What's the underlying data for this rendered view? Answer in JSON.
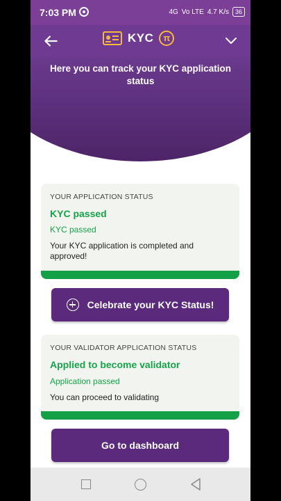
{
  "status_bar": {
    "time": "7:03 PM",
    "network": "4G",
    "volte": "Vo LTE",
    "speed": "4.7 K/s",
    "battery": "36"
  },
  "header": {
    "title": "KYC",
    "pi_symbol": "π"
  },
  "hero": {
    "text": "Here you can track your KYC application status"
  },
  "kyc_card": {
    "caption": "YOUR APPLICATION STATUS",
    "title": "KYC passed",
    "subtitle": "KYC passed",
    "description": "Your KYC application is completed and approved!"
  },
  "celebrate_button": {
    "label": "Celebrate your KYC Status!"
  },
  "validator_card": {
    "caption": "YOUR VALIDATOR APPLICATION STATUS",
    "title": "Applied to become validator",
    "subtitle": "Application passed",
    "description": "You can proceed to validating"
  },
  "dashboard_button": {
    "label": "Go to dashboard"
  },
  "colors": {
    "header_purple": "#6f3a92",
    "success_green": "#16a34a",
    "button_purple": "#5b2a7c"
  }
}
